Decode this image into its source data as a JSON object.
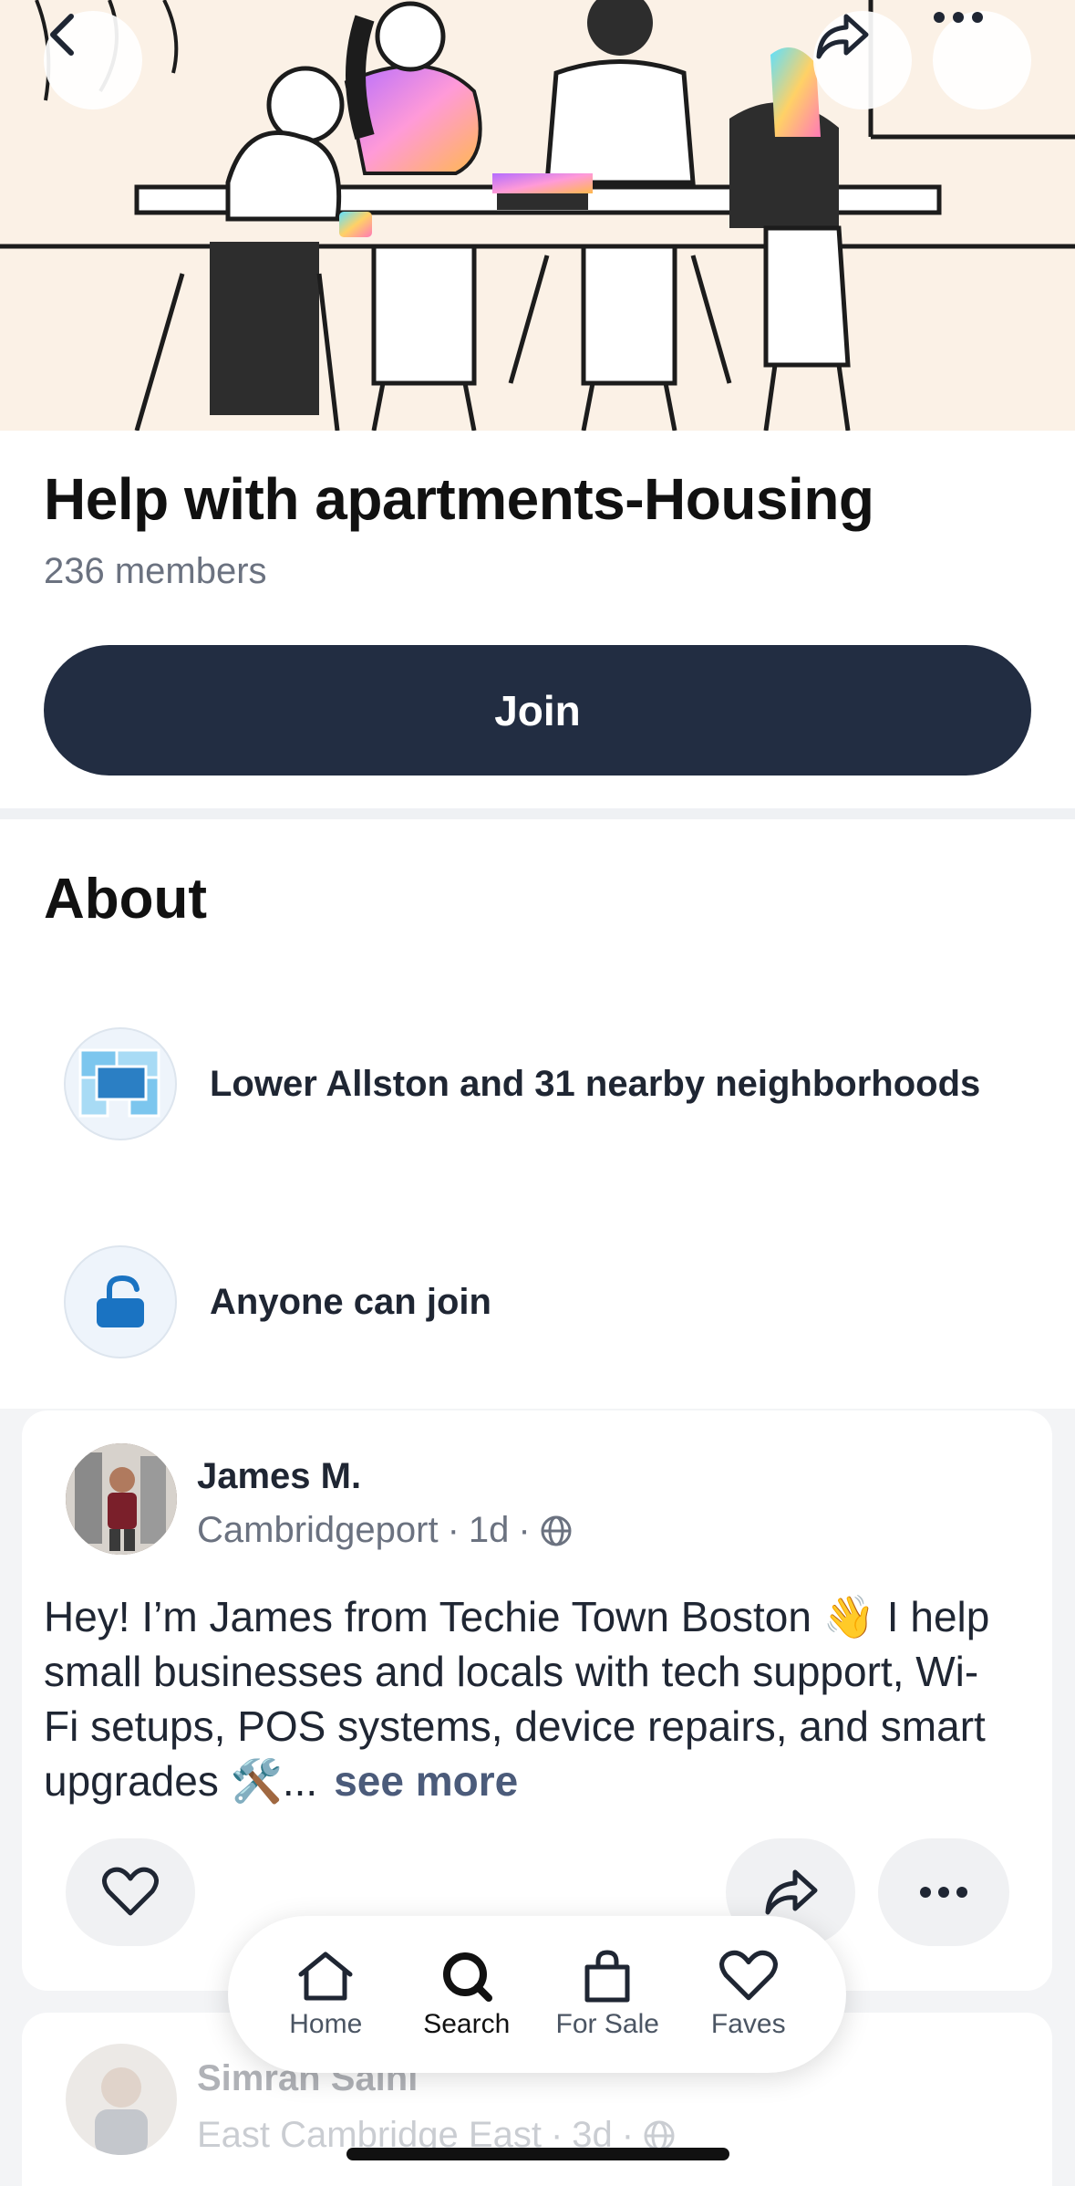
{
  "header": {
    "title": "Help with apartments-Housing",
    "members": "236 members",
    "join_label": "Join"
  },
  "nav_icons": {
    "back": "chevron-left-icon",
    "share": "share-icon",
    "more": "more-horizontal-icon"
  },
  "about": {
    "title": "About",
    "items": [
      {
        "icon": "map-icon",
        "text": "Lower Allston and 31 nearby neighborhoods"
      },
      {
        "icon": "unlock-icon",
        "text": "Anyone can join"
      }
    ]
  },
  "posts": [
    {
      "author": "James M.",
      "neighborhood": "Cambridgeport",
      "time": "1d",
      "body": "Hey! I’m James from Techie Town Boston 👋 I help small businesses and locals with tech support, Wi-Fi setups, POS systems, device repairs, and smart upgrades 🛠️...",
      "see_more": "see more"
    },
    {
      "author": "Simran Saini",
      "neighborhood": "East Cambridge East",
      "time": "3d"
    }
  ],
  "meta_separator": "·",
  "tabbar": {
    "tabs": [
      {
        "label": "Home",
        "icon": "home-icon"
      },
      {
        "label": "Search",
        "icon": "search-icon"
      },
      {
        "label": "For Sale",
        "icon": "shopping-bag-icon"
      },
      {
        "label": "Faves",
        "icon": "heart-icon"
      }
    ],
    "active": "Search"
  },
  "colors": {
    "primary_dark": "#222d42",
    "hero_bg": "#fbf1e6",
    "muted_text": "#6b7280",
    "link": "#4b5b7a"
  }
}
